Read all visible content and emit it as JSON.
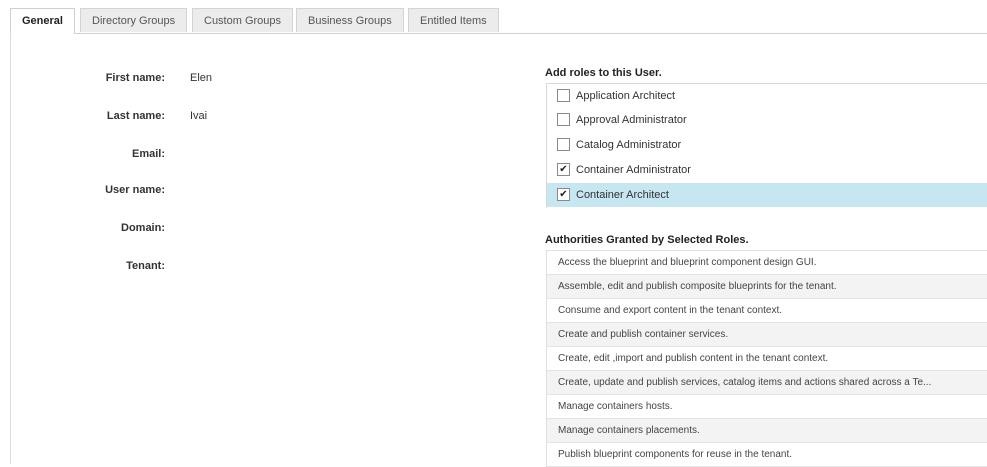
{
  "tabs": [
    {
      "label": "General",
      "active": true
    },
    {
      "label": "Directory Groups",
      "active": false
    },
    {
      "label": "Custom Groups",
      "active": false
    },
    {
      "label": "Business Groups",
      "active": false
    },
    {
      "label": "Entitled Items",
      "active": false
    }
  ],
  "form": {
    "first_name_label": "First name:",
    "first_name_value": "Elen",
    "last_name_label": "Last name:",
    "last_name_value": "Ivai",
    "email_label": "Email:",
    "email_value": "",
    "username_label": "User name:",
    "username_value": "",
    "domain_label": "Domain:",
    "domain_value": "",
    "tenant_label": "Tenant:",
    "tenant_value": ""
  },
  "roles": {
    "title": "Add roles to this User.",
    "items": [
      {
        "label": "Application Architect",
        "checked": false,
        "selected": false
      },
      {
        "label": "Approval Administrator",
        "checked": false,
        "selected": false
      },
      {
        "label": "Catalog Administrator",
        "checked": false,
        "selected": false
      },
      {
        "label": "Container Administrator",
        "checked": true,
        "selected": false
      },
      {
        "label": "Container Architect",
        "checked": true,
        "selected": true
      }
    ]
  },
  "authorities": {
    "title": "Authorities Granted by Selected Roles.",
    "items": [
      "Access the blueprint and blueprint component design GUI.",
      "Assemble, edit and publish composite blueprints for the tenant.",
      "Consume and export content in the tenant context.",
      "Create and publish container services.",
      "Create, edit ,import and publish content in the tenant context.",
      "Create, update and publish services, catalog items and actions shared across a Te...",
      "Manage containers hosts.",
      "Manage containers placements.",
      "Publish blueprint components for reuse in the tenant."
    ]
  },
  "colors": {
    "selected_row": "#c6e6f2",
    "tab_background": "#ececec"
  }
}
